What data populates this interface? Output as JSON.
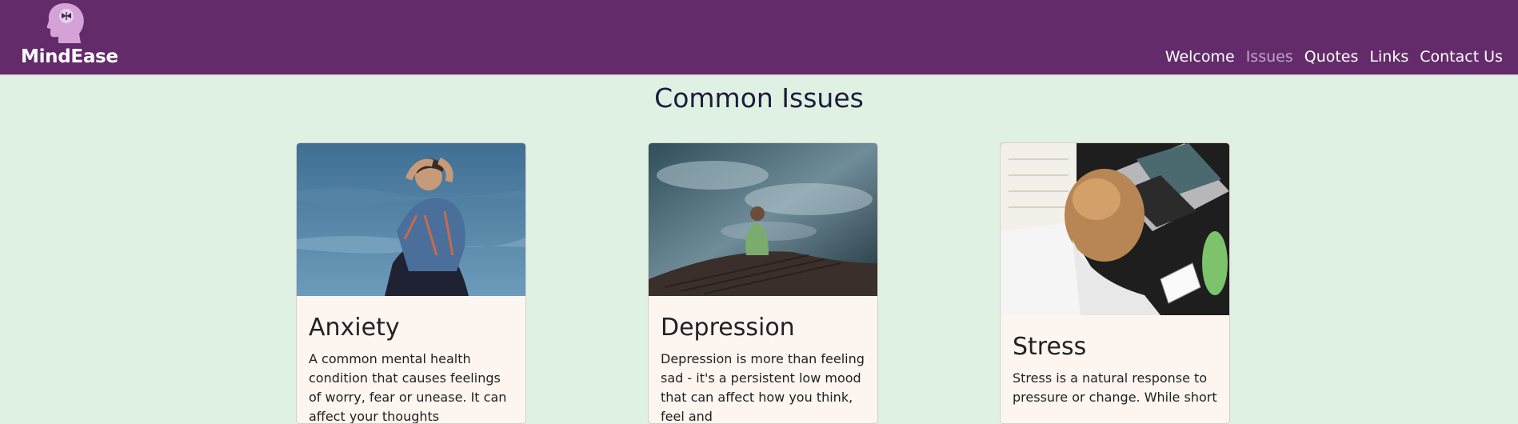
{
  "brand": {
    "name": "MindEase"
  },
  "nav": {
    "links": [
      "Welcome",
      "Issues",
      "Quotes",
      "Links",
      "Contact Us"
    ],
    "active": "Issues"
  },
  "page": {
    "title": "Common Issues"
  },
  "cards": [
    {
      "title": "Anxiety",
      "text": "A common mental health condition that causes feelings of worry, fear or unease. It can affect your thoughts"
    },
    {
      "title": "Depression",
      "text": "Depression is more than feeling sad - it's a persistent low mood that can affect how you think, feel and"
    },
    {
      "title": "Stress",
      "text": "Stress is a natural response to pressure or change. While short"
    }
  ],
  "colors": {
    "navbar": "#642b6b",
    "background": "#dff1e3",
    "card": "#fdf5f0",
    "active_link": "#bfa7c4"
  },
  "icons": {
    "logo": "head-with-butterfly-icon"
  }
}
